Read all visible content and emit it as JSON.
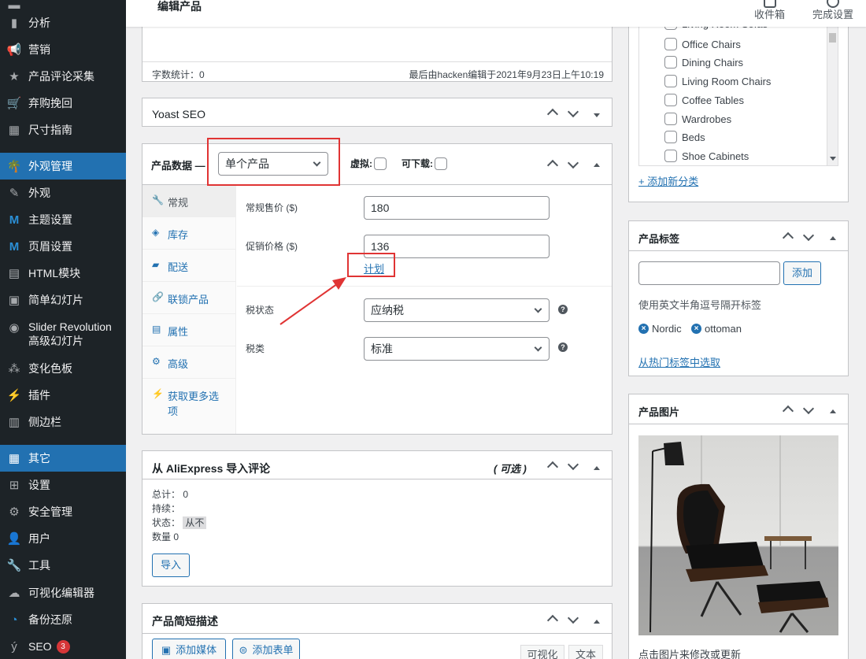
{
  "sidebar": {
    "items": [
      {
        "label": "分析",
        "icon": "chart-icon"
      },
      {
        "label": "营销",
        "icon": "megaphone-icon"
      },
      {
        "label": "产品评论采集",
        "icon": "star-icon"
      },
      {
        "label": "弃购挽回",
        "icon": "cart-icon"
      },
      {
        "label": "尺寸指南",
        "icon": "ruler-icon"
      },
      {
        "label": "外观管理",
        "icon": "palm-icon"
      },
      {
        "label": "外观",
        "icon": "brush-icon"
      },
      {
        "label": "主题设置",
        "icon": "m-logo-icon"
      },
      {
        "label": "页眉设置",
        "icon": "m-logo-icon"
      },
      {
        "label": "HTML模块",
        "icon": "grid-icon"
      },
      {
        "label": "简单幻灯片",
        "icon": "image-icon"
      },
      {
        "label": "Slider Revolution",
        "label2": "高级幻灯片",
        "icon": "slider-icon"
      },
      {
        "label": "变化色板",
        "icon": "swatch-icon"
      },
      {
        "label": "插件",
        "icon": "plugin-icon"
      },
      {
        "label": "侧边栏",
        "icon": "sidebar-icon"
      },
      {
        "label": "其它",
        "icon": "apps-icon"
      },
      {
        "label": "设置",
        "icon": "settings-icon"
      },
      {
        "label": "安全管理",
        "icon": "shield-gear-icon"
      },
      {
        "label": "用户",
        "icon": "user-icon"
      },
      {
        "label": "工具",
        "icon": "wrench-icon"
      },
      {
        "label": "可视化编辑器",
        "icon": "cloud-icon"
      },
      {
        "label": "备份还原",
        "icon": "backup-icon"
      },
      {
        "label": "SEO",
        "icon": "yoast-icon",
        "badge": "3"
      }
    ]
  },
  "header": {
    "title": "编辑产品",
    "inbox": "收件箱",
    "setup": "完成设置"
  },
  "editor": {
    "word_count": "字数统计：0",
    "last_edited": "最后由hacken编辑于2021年9月23日上午10:19"
  },
  "yoast": {
    "title": "Yoast SEO"
  },
  "product_data": {
    "title": "产品数据 —",
    "type_value": "单个产品",
    "virtual_label": "虚拟:",
    "downloadable_label": "可下载:",
    "tabs": [
      {
        "label": "常规",
        "icon": "wrench-icon"
      },
      {
        "label": "库存",
        "icon": "tag-icon"
      },
      {
        "label": "配送",
        "icon": "truck-icon"
      },
      {
        "label": "联锁产品",
        "icon": "link-icon"
      },
      {
        "label": "属性",
        "icon": "list-icon"
      },
      {
        "label": "高级",
        "icon": "gear-icon"
      },
      {
        "label": "获取更多选",
        "label2": "项",
        "icon": "plug-icon"
      }
    ],
    "regular_price_label": "常规售价 ($)",
    "regular_price_value": "180",
    "sale_price_label": "促销价格 ($)",
    "sale_price_value": "136",
    "schedule_link": "计划",
    "tax_status_label": "税状态",
    "tax_status_value": "应纳税",
    "tax_class_label": "税类",
    "tax_class_value": "标准"
  },
  "aliexpress": {
    "title": "从 AliExpress 导入评论",
    "optional": "( 可选 )",
    "total_label": "总计：",
    "total_value": "0",
    "duration_label": "持续：",
    "status_label": "状态：",
    "status_value": "从不",
    "count_label": "数量",
    "count_value": "0",
    "import_button": "导入"
  },
  "short_desc": {
    "title": "产品简短描述",
    "add_media": "添加媒体",
    "add_form": "添加表单",
    "tab_visual": "可视化",
    "tab_text": "文本"
  },
  "categories": {
    "partial_item": "Living Room Sofas",
    "items": [
      "Office Chairs",
      "Dining Chairs",
      "Living Room Chairs",
      "Coffee Tables",
      "Wardrobes",
      "Beds",
      "Shoe Cabinets"
    ],
    "add_new": "+ 添加新分类"
  },
  "tags": {
    "title": "产品标签",
    "add_button": "添加",
    "hint": "使用英文半角逗号隔开标签",
    "items": [
      "Nordic",
      "ottoman"
    ],
    "choose_popular": "从热门标签中选取"
  },
  "product_image": {
    "title": "产品图片",
    "hint": "点击图片来修改或更新"
  },
  "colors": {
    "sidebar_bg": "#1d2327",
    "accent": "#2271b1",
    "annotation": "#e03434"
  }
}
